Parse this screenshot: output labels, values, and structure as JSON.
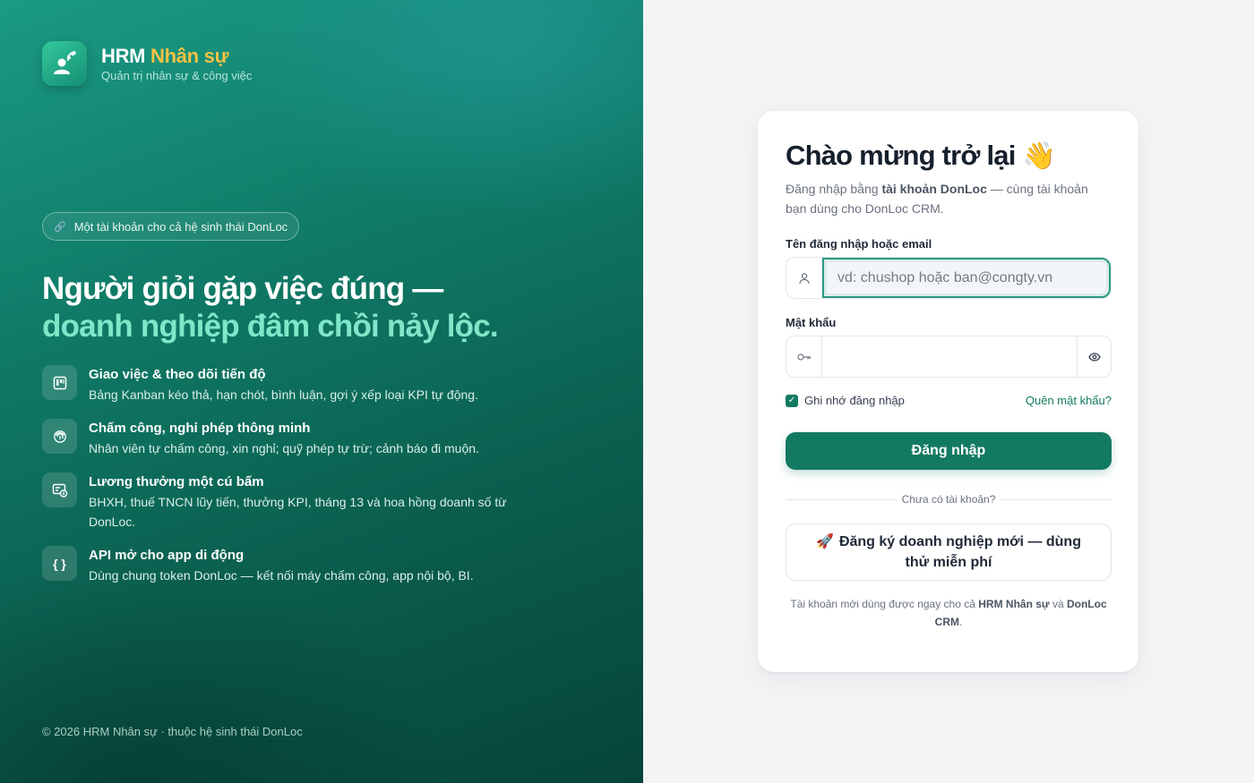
{
  "brand": {
    "name_part1": "HRM ",
    "name_part2": "Nhân sự",
    "subtitle": "Quản trị nhân sự & công việc"
  },
  "left": {
    "pill": "Một tài khoản cho cả hệ sinh thái DonLoc",
    "headline_line1": "Người giỏi gặp việc đúng —",
    "headline_line2": "doanh nghiệp đâm chồi nảy lộc.",
    "features": [
      {
        "icon": "kanban-icon",
        "title": "Giao việc & theo dõi tiến độ",
        "desc": "Bảng Kanban kéo thả, hạn chót, bình luận, gợi ý xếp loại KPI tự động."
      },
      {
        "icon": "fingerprint-icon",
        "title": "Chấm công, nghỉ phép thông minh",
        "desc": "Nhân viên tự chấm công, xin nghỉ; quỹ phép tự trừ; cảnh báo đi muộn."
      },
      {
        "icon": "payroll-icon",
        "title": "Lương thưởng một cú bấm",
        "desc": "BHXH, thuế TNCN lũy tiến, thưởng KPI, tháng 13 và hoa hồng doanh số từ DonLoc."
      },
      {
        "icon": "api-braces-icon",
        "glyph": "{ }",
        "title": "API mở cho app di động",
        "desc": "Dùng chung token DonLoc — kết nối máy chấm công, app nội bộ, BI."
      }
    ],
    "copyright": "© 2026 HRM Nhân sự · thuộc hệ sinh thái DonLoc"
  },
  "login": {
    "title": "Chào mừng trở lại",
    "wave": "👋",
    "intro_pre": "Đăng nhập bằng ",
    "intro_bold": "tài khoản DonLoc",
    "intro_post": " — cùng tài khoản bạn dùng cho DonLoc CRM.",
    "username_label": "Tên đăng nhập hoặc email",
    "username_placeholder": "vd: chushop hoặc ban@congty.vn",
    "username_value": "",
    "password_label": "Mật khẩu",
    "password_value": "",
    "remember_label": "Ghi nhớ đăng nhập",
    "remember_checked": true,
    "forgot_label": "Quên mật khẩu?",
    "submit_label": "Đăng nhập",
    "divider_label": "Chưa có tài khoản?",
    "register_label": "Đăng ký doanh nghiệp mới — dùng thử miễn phí",
    "note_pre": "Tài khoản mới dùng được ngay cho cả ",
    "note_b1": "HRM Nhân sự",
    "note_mid": " và ",
    "note_b2": "DonLoc CRM",
    "note_end": "."
  },
  "colors": {
    "brand_green": "#137a62",
    "accent_yellow": "#f5c242",
    "headline_mint": "#7fe6c8",
    "page_bg": "#f3f4f6"
  }
}
